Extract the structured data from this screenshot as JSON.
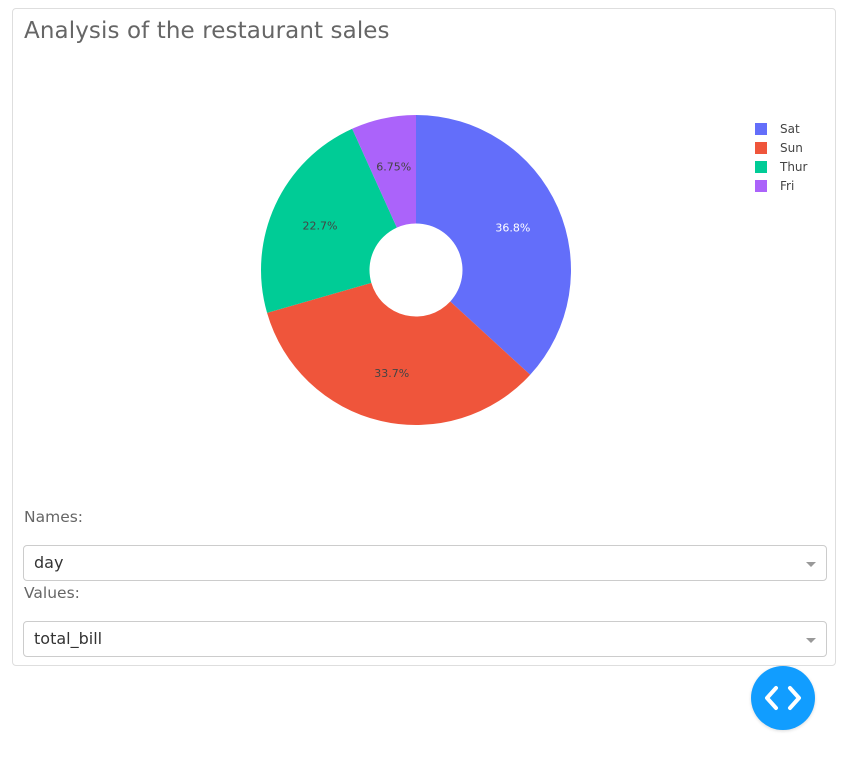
{
  "page": {
    "title": "Analysis of the restaurant sales"
  },
  "controls": {
    "names_label": "Names:",
    "names_value": "day",
    "values_label": "Values:",
    "values_value": "total_bill"
  },
  "chart_data": {
    "type": "pie",
    "hole": 0.3,
    "title": "",
    "categories": [
      "Sat",
      "Sun",
      "Thur",
      "Fri"
    ],
    "values": [
      36.8,
      33.7,
      22.7,
      6.75
    ],
    "labels": [
      "36.8%",
      "33.7%",
      "22.7%",
      "6.75%"
    ],
    "colors": [
      "#636efa",
      "#ef553b",
      "#00cc96",
      "#ab63fa"
    ],
    "label_colors": [
      "#ffffff",
      "#444444",
      "#444444",
      "#444444"
    ],
    "legend_position": "top-right",
    "direction": "clockwise",
    "rotation_start": "top"
  },
  "icons": {
    "fab": "code-brackets-icon"
  }
}
